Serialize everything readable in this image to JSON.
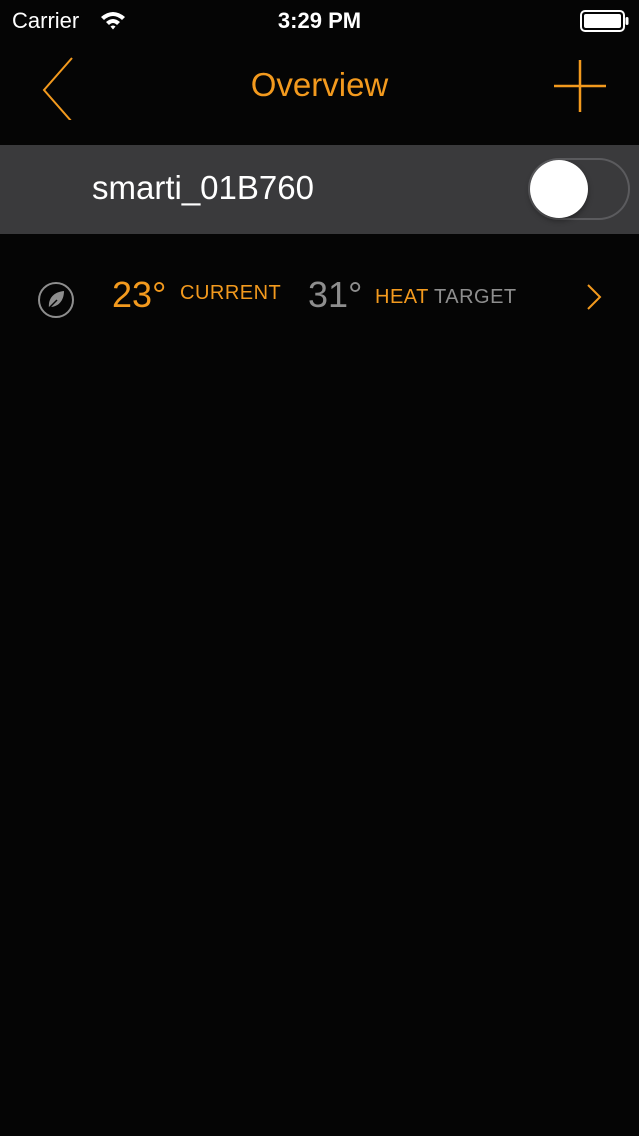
{
  "status_bar": {
    "carrier": "Carrier",
    "time": "3:29 PM",
    "wifi_icon": "wifi-icon",
    "battery_icon": "battery-icon"
  },
  "nav": {
    "title": "Overview",
    "back_icon": "chevron-left-icon",
    "add_icon": "plus-icon"
  },
  "device": {
    "name": "smarti_01B760",
    "power_on": false
  },
  "zone": {
    "mode_icon": "leaf-icon",
    "current_temp": "23°",
    "current_label": "CURRENT",
    "target_temp": "31°",
    "mode_label": "HEAT",
    "target_label": "TARGET",
    "chevron_icon": "chevron-right-icon"
  },
  "colors": {
    "accent": "#f39a1e",
    "background": "#050505",
    "row_background": "#3a3a3c",
    "muted_text": "#8e8e8e"
  }
}
